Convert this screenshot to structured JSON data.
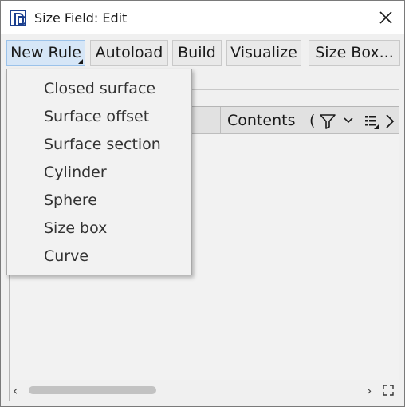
{
  "window": {
    "title": "Size Field: Edit"
  },
  "icons": {
    "app": "app-logo-icon",
    "close": "close-icon",
    "filter": "filter-icon",
    "chevron": "chevron-down-icon",
    "columns": "column-chooser-icon",
    "scroll_right": "chevron-right-icon"
  },
  "toolbar": {
    "new_rule_label": "New Rule",
    "autoload_label": "Autoload",
    "build_label": "Build",
    "visualize_label": "Visualize",
    "size_box_label": "Size Box..."
  },
  "menu": {
    "items": [
      "Closed surface",
      "Surface offset",
      "Surface section",
      "Cylinder",
      "Sphere",
      "Size box",
      "Curve"
    ]
  },
  "grid": {
    "columns": [
      "Contents",
      "("
    ],
    "rows": []
  },
  "colors": {
    "active_button": "#d6e6f7",
    "active_border": "#9bc2ea",
    "menu_background": "#f2f2f2"
  }
}
